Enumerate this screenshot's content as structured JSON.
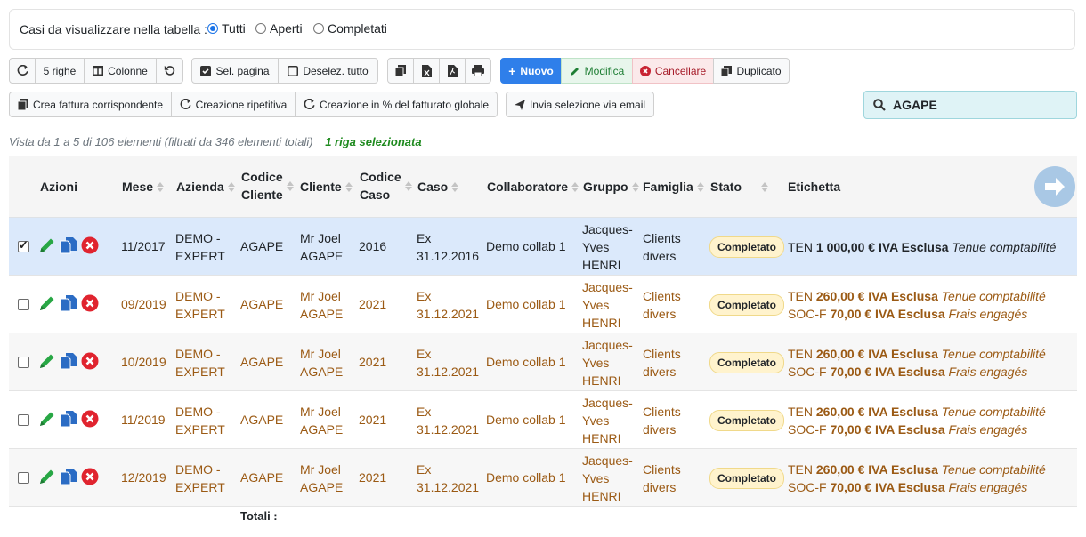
{
  "filter": {
    "label": "Casi da visualizzare nella tabella :",
    "options": [
      "Tutti",
      "Aperti",
      "Completati"
    ],
    "selected": "Tutti"
  },
  "toolbar": {
    "rows_label": "5 righe",
    "columns_label": "Colonne",
    "select_page_label": "Sel. pagina",
    "deselect_all_label": "Deselez. tutto",
    "new_label": "Nuovo",
    "edit_label": "Modifica",
    "delete_label": "Cancellare",
    "duplicate_label": "Duplicato",
    "create_invoice_label": "Crea fattura corrispondente",
    "repeat_label": "Creazione ripetitiva",
    "percent_label": "Creazione in % del fatturato globale",
    "email_label": "Invia selezione via email"
  },
  "search": {
    "value": "AGAPE"
  },
  "info": {
    "summary": "Vista da 1 a 5 di 106 elementi (filtrati da 346 elementi totali)",
    "selected": "1 riga selezionata"
  },
  "table": {
    "headers": {
      "azioni": "Azioni",
      "mese": "Mese",
      "azienda": "Azienda",
      "codice_cliente": [
        "Codice",
        "Cliente"
      ],
      "cliente": "Cliente",
      "codice_caso": [
        "Codice",
        "Caso"
      ],
      "caso": "Caso",
      "collaboratore": "Collaboratore",
      "gruppo": "Gruppo",
      "famiglia": "Famiglia",
      "stato": "Stato",
      "etichetta": "Etichetta"
    },
    "rows": [
      {
        "selected": true,
        "mese": "11/2017",
        "azienda": [
          "DEMO -",
          "EXPERT"
        ],
        "codice_cliente": "AGAPE",
        "cliente": [
          "Mr Joel",
          "AGAPE"
        ],
        "codice_caso": "2016",
        "caso": [
          "Ex",
          "31.12.2016"
        ],
        "collaboratore": "Demo collab 1",
        "gruppo": [
          "Jacques-",
          "Yves",
          "HENRI"
        ],
        "famiglia": [
          "Clients",
          "divers"
        ],
        "stato": "Completato",
        "etichetta": [
          {
            "code": "TEN",
            "amount": "1 000,00 € IVA Esclusa",
            "desc": "Tenue comptabilité"
          }
        ]
      },
      {
        "selected": false,
        "mese": "09/2019",
        "azienda": [
          "DEMO -",
          "EXPERT"
        ],
        "codice_cliente": "AGAPE",
        "cliente": [
          "Mr Joel",
          "AGAPE"
        ],
        "codice_caso": "2021",
        "caso": [
          "Ex",
          "31.12.2021"
        ],
        "collaboratore": "Demo collab 1",
        "gruppo": [
          "Jacques-",
          "Yves",
          "HENRI"
        ],
        "famiglia": [
          "Clients",
          "divers"
        ],
        "stato": "Completato",
        "etichetta": [
          {
            "code": "TEN",
            "amount": "260,00 € IVA Esclusa",
            "desc": "Tenue comptabilité"
          },
          {
            "code": "SOC-F",
            "amount": "70,00 € IVA Esclusa",
            "desc": "Frais engagés"
          }
        ]
      },
      {
        "selected": false,
        "mese": "10/2019",
        "azienda": [
          "DEMO -",
          "EXPERT"
        ],
        "codice_cliente": "AGAPE",
        "cliente": [
          "Mr Joel",
          "AGAPE"
        ],
        "codice_caso": "2021",
        "caso": [
          "Ex",
          "31.12.2021"
        ],
        "collaboratore": "Demo collab 1",
        "gruppo": [
          "Jacques-",
          "Yves",
          "HENRI"
        ],
        "famiglia": [
          "Clients",
          "divers"
        ],
        "stato": "Completato",
        "etichetta": [
          {
            "code": "TEN",
            "amount": "260,00 € IVA Esclusa",
            "desc": "Tenue comptabilité"
          },
          {
            "code": "SOC-F",
            "amount": "70,00 € IVA Esclusa",
            "desc": "Frais engagés"
          }
        ]
      },
      {
        "selected": false,
        "mese": "11/2019",
        "azienda": [
          "DEMO -",
          "EXPERT"
        ],
        "codice_cliente": "AGAPE",
        "cliente": [
          "Mr Joel",
          "AGAPE"
        ],
        "codice_caso": "2021",
        "caso": [
          "Ex",
          "31.12.2021"
        ],
        "collaboratore": "Demo collab 1",
        "gruppo": [
          "Jacques-",
          "Yves",
          "HENRI"
        ],
        "famiglia": [
          "Clients",
          "divers"
        ],
        "stato": "Completato",
        "etichetta": [
          {
            "code": "TEN",
            "amount": "260,00 € IVA Esclusa",
            "desc": "Tenue comptabilité"
          },
          {
            "code": "SOC-F",
            "amount": "70,00 € IVA Esclusa",
            "desc": "Frais engagés"
          }
        ]
      },
      {
        "selected": false,
        "mese": "12/2019",
        "azienda": [
          "DEMO -",
          "EXPERT"
        ],
        "codice_cliente": "AGAPE",
        "cliente": [
          "Mr Joel",
          "AGAPE"
        ],
        "codice_caso": "2021",
        "caso": [
          "Ex",
          "31.12.2021"
        ],
        "collaboratore": "Demo collab 1",
        "gruppo": [
          "Jacques-",
          "Yves",
          "HENRI"
        ],
        "famiglia": [
          "Clients",
          "divers"
        ],
        "stato": "Completato",
        "etichetta": [
          {
            "code": "TEN",
            "amount": "260,00 € IVA Esclusa",
            "desc": "Tenue comptabilité"
          },
          {
            "code": "SOC-F",
            "amount": "70,00 € IVA Esclusa",
            "desc": "Frais engagés"
          }
        ]
      }
    ],
    "totals_label": "Totali :"
  },
  "colors": {
    "primary": "#2f7fea",
    "selected_row": "#dbe9fb",
    "brown_text": "#9b5a14",
    "badge_bg": "#fff3cd",
    "edit_green": "#28a745",
    "delete_red": "#e0242f",
    "doc_blue": "#2b6cc4"
  }
}
